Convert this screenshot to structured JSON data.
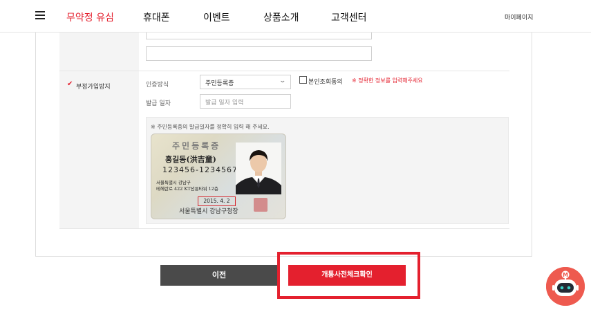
{
  "nav": {
    "items": [
      "무약정 유심",
      "휴대폰",
      "이벤트",
      "상품소개",
      "고객센터"
    ],
    "mypage": "마이페이지"
  },
  "form": {
    "section_label": "부정가입방지",
    "auth_method_label": "인증방식",
    "auth_method_value": "주민등록증",
    "consent_label": "본인조회동의",
    "warning": "※ 정확한 정보를 입력해주세요",
    "issue_date_label": "발급 일자",
    "issue_date_placeholder": "발급 일자 입력",
    "hint": "※ 주민등록증의 발급일자를 정확히 입력 해 주세요."
  },
  "id_card": {
    "title": "주민등록증",
    "name": "홍길동(洪吉童)",
    "number": "123456-1234567",
    "address_line1": "서울특별시 강남구",
    "address_line2": "테헤란로 422 KT선릉타워 12층",
    "issue_date": "2015. 4. 2",
    "issuer": "서울특별시 강남구청장"
  },
  "buttons": {
    "prev": "이전",
    "next": "개통사전체크확인"
  },
  "colors": {
    "accent": "#e4202e",
    "prev_button": "#4a4a4a",
    "chatbot": "#ee5a4f"
  },
  "icons": [
    "hamburger-icon",
    "chevron-down-icon",
    "check-icon",
    "chatbot-robot-icon"
  ]
}
